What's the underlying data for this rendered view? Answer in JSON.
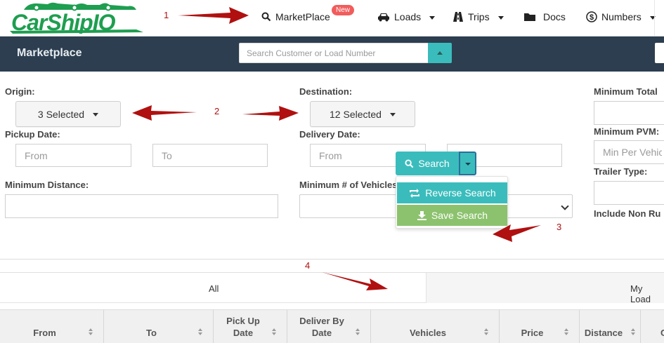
{
  "logo": {
    "text": "CarShipIO"
  },
  "nav": {
    "items": [
      {
        "label": "MarketPlace",
        "icon": "search-icon"
      },
      {
        "label": "Loads",
        "icon": "car-icon"
      },
      {
        "label": "Trips",
        "icon": "road-icon"
      },
      {
        "label": "Docs",
        "icon": "folder-icon"
      },
      {
        "label": "Numbers",
        "icon": "dollar-icon"
      }
    ],
    "badge": "New"
  },
  "bar": {
    "title": "Marketplace",
    "search_placeholder": "Search Customer or Load Number"
  },
  "filters": {
    "origin_label": "Origin:",
    "origin_value": "3 Selected",
    "destination_label": "Destination:",
    "destination_value": "12 Selected",
    "pickup_label": "Pickup Date:",
    "delivery_label": "Delivery Date:",
    "from_placeholder": "From",
    "to_placeholder": "To",
    "min_distance_label": "Minimum Distance:",
    "min_vehicles_label": "Minimum # of Vehicles:",
    "min_total_label": "Minimum Total",
    "min_pvm_label": "Minimum PVM:",
    "min_pvm_placeholder": "Min Per Vehic",
    "trailer_label": "Trailer Type:",
    "include_label": "Include Non Ru"
  },
  "actions": {
    "search_label": "Search",
    "reverse_label": "Reverse Search",
    "save_label": "Save Search"
  },
  "tabs": {
    "all": "All",
    "my": "My Load"
  },
  "table": {
    "headers": [
      {
        "line1": "From",
        "line2": ""
      },
      {
        "line1": "To",
        "line2": ""
      },
      {
        "line1": "Pick Up",
        "line2": "Date"
      },
      {
        "line1": "Deliver By",
        "line2": "Date"
      },
      {
        "line1": "Vehicles",
        "line2": ""
      },
      {
        "line1": "Price",
        "line2": ""
      },
      {
        "line1": "Distance",
        "line2": ""
      },
      {
        "line1": "C",
        "line2": ""
      }
    ]
  },
  "annotations": [
    "1",
    "2",
    "3",
    "4"
  ],
  "colors": {
    "nav_bar": "#2c3e50",
    "teal": "#3bbcbc",
    "green": "#8cc26e",
    "badge": "#f25c5c",
    "arrow": "#b01010"
  }
}
